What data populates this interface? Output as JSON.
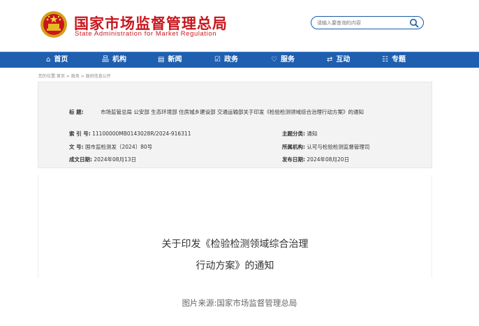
{
  "header": {
    "title_cn": "国家市场监督管理总局",
    "title_en": "State Administration for Market Regulation",
    "emblem_icon": "national-emblem-icon",
    "search": {
      "placeholder": "请输入要查询的内容",
      "icon": "search-icon"
    }
  },
  "nav": {
    "items": [
      {
        "label": "首页",
        "icon": "home-icon",
        "glyph": "⌂"
      },
      {
        "label": "机构",
        "icon": "organization-icon",
        "glyph": "品"
      },
      {
        "label": "新闻",
        "icon": "news-icon",
        "glyph": "▤"
      },
      {
        "label": "政务",
        "icon": "government-affairs-icon",
        "glyph": "☑"
      },
      {
        "label": "服务",
        "icon": "service-heart-icon",
        "glyph": "♡"
      },
      {
        "label": "互动",
        "icon": "interaction-arrows-icon",
        "glyph": "⇄"
      },
      {
        "label": "专题",
        "icon": "topics-icon",
        "glyph": "☷"
      }
    ]
  },
  "breadcrumb": "您的位置:首页 > 政务 > 政府信息公开",
  "doc_meta": {
    "title_label": "标  题:",
    "title_value": "市场监管总局 公安部 生态环境部 住房城乡建设部 交通运输部关于印发《检验检测领域综合治理行动方案》的通知",
    "index_label": "索 引 号:",
    "index_value": "11100000MB0143028R/2024-916311",
    "category_label": "主题分类:",
    "category_value": "通知",
    "doc_no_label": "文    号:",
    "doc_no_value": "国市监检测发〔2024〕80号",
    "org_label": "所属机构:",
    "org_value": "认可与检验检测监督管理司",
    "created_label": "成文日期:",
    "created_value": "2024年08月13日",
    "published_label": "发布日期:",
    "published_value": "2024年08月20日"
  },
  "document": {
    "title_line1": "关于印发《检验检测领域综合治理",
    "title_line2": "行动方案》的通知"
  },
  "caption": "图片来源:国家市场监督管理总局",
  "colors": {
    "brand_red": "#c8161d",
    "nav_blue": "#1f5fb0"
  }
}
